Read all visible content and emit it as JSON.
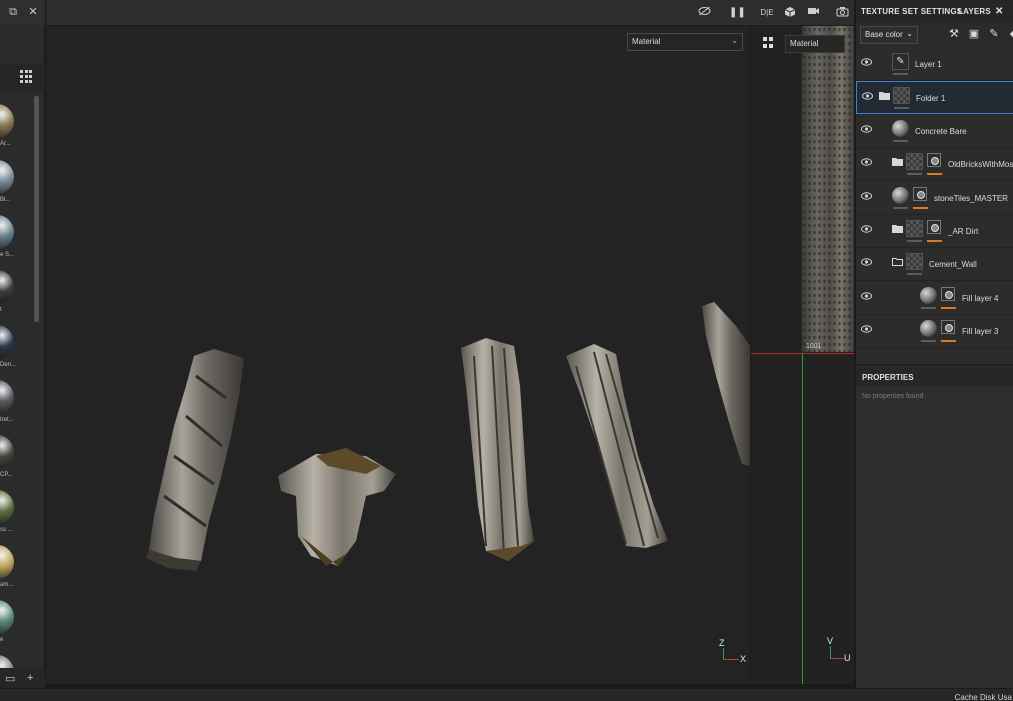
{
  "viewport": {
    "display_channel": "Material",
    "uv_channel": "Material",
    "uv_tile": "1001",
    "gizmo_3d": [
      "Z",
      "X"
    ],
    "gizmo_uv": [
      "V",
      "U"
    ]
  },
  "shelf": {
    "materials": [
      {
        "label": "Ar...",
        "color": "#8a7a55"
      },
      {
        "label": "Bl...",
        "color": "#7b8e9a"
      },
      {
        "label": "e S...",
        "color": "#6b7f8e"
      },
      {
        "label": "t",
        "color": "#3a3c40"
      },
      {
        "label": "Den...",
        "color": "#2d3a4c"
      },
      {
        "label": "tret...",
        "color": "#55595e"
      },
      {
        "label": "CP...",
        "color": "#42453f"
      },
      {
        "label": "ss ...",
        "color": "#5c6e3e"
      },
      {
        "label": "am...",
        "color": "#c0a35c"
      },
      {
        "label": "e",
        "color": "#5c8a77"
      },
      {
        "label": "",
        "color": "#7a7a7a"
      }
    ]
  },
  "panel": {
    "tab_texture_set": "TEXTURE SET SETTINGS",
    "tab_layers": "LAYERS",
    "channel": "Base color",
    "layers": [
      {
        "name": "Layer 1",
        "kind": "paint",
        "indent": 0
      },
      {
        "name": "Folder 1",
        "kind": "folder",
        "indent": 0,
        "selected": true
      },
      {
        "name": "Concrete Bare",
        "kind": "fill",
        "indent": 0
      },
      {
        "name": "OldBricksWithMoss",
        "kind": "folder-mask",
        "indent": 1
      },
      {
        "name": "stoneTiles_MASTER",
        "kind": "fill-mask",
        "indent": 0
      },
      {
        "name": "_AR Dirt",
        "kind": "folder-mask",
        "indent": 1
      },
      {
        "name": "Cement_Wall",
        "kind": "folder",
        "indent": 1
      },
      {
        "name": "Fill layer 4",
        "kind": "fill-mask",
        "indent": 2
      },
      {
        "name": "Fill layer 3",
        "kind": "fill-mask",
        "indent": 2
      }
    ],
    "properties_title": "PROPERTIES",
    "properties_empty": "No properties found"
  },
  "status": {
    "text": "Cache Disk Usa"
  },
  "colors": {
    "accent_orange": "#e07a1f",
    "selection_blue": "#3f7fcc",
    "uv_axis_red": "#b0272a",
    "uv_axis_green": "#2f9b3c"
  }
}
